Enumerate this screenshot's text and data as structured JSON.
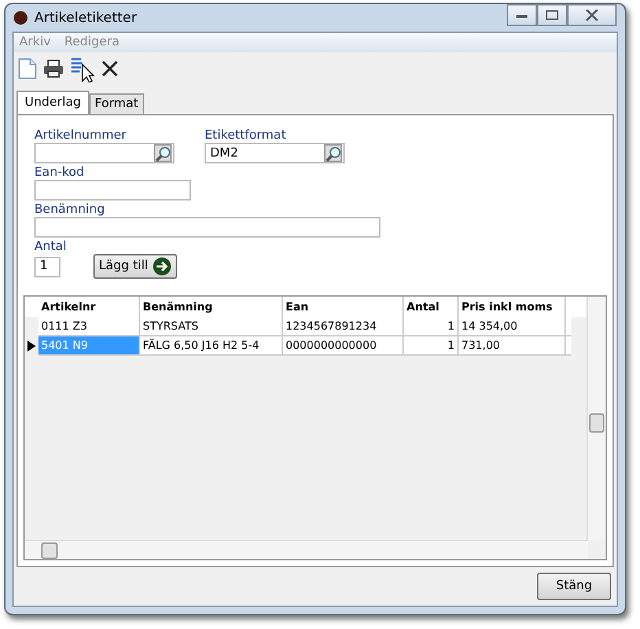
{
  "window": {
    "title": "Artikeletiketter"
  },
  "menu": [
    {
      "label": "Arkiv",
      "disabled": true
    },
    {
      "label": "Redigera",
      "disabled": true
    }
  ],
  "tabs": [
    {
      "label": "Underlag",
      "selected": true
    },
    {
      "label": "Format",
      "selected": false
    }
  ],
  "form": {
    "article_number": {
      "label": "Artikelnummer"
    },
    "label_format": {
      "label": "Etikettformat",
      "value": "DM2"
    },
    "ean": {
      "label": "Ean-kod"
    },
    "name": {
      "label": "Benämning"
    },
    "quantity": {
      "label": "Antal",
      "value": "1"
    },
    "add_button": "Lägg till"
  },
  "table": {
    "columns": [
      "Artikelnr",
      "Benämning",
      "Ean",
      "Antal",
      "Pris inkl moms"
    ],
    "rows": [
      {
        "selected": false,
        "cells": [
          "0111 Z3",
          "STYRSATS",
          "1234567891234",
          "1",
          "14 354,00"
        ]
      },
      {
        "selected": true,
        "cells": [
          "5401 N9",
          "FÄLG 6,50 J16 H2 5-4",
          "0000000000000",
          "1",
          "731,00"
        ]
      }
    ]
  },
  "close_button": "Stäng"
}
